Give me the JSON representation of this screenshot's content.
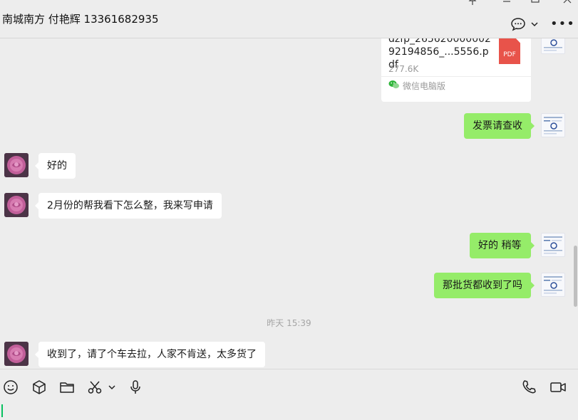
{
  "header": {
    "title": "南城南方 付艳辉 13361682935",
    "icons": [
      "chat-bubble-icon",
      "chevron-down-icon",
      "more-icon"
    ]
  },
  "window_controls": [
    "pin-icon",
    "minimize-icon",
    "maximize-icon",
    "close-icon"
  ],
  "messages": {
    "file": {
      "name": "dzfp_26562000000292194856_...5556.pdf",
      "size": "277.6K",
      "type_label": "PDF",
      "source": "微信电脑版"
    },
    "invoice_notice": "发票请查收",
    "reply_ok": "好的",
    "reply_help": "2月份的帮我看下怎么整，我来写申请",
    "ok_wait": "好的 稍等",
    "goods_received_q": "那批货都收到了吗",
    "timestamp": "昨天 15:39",
    "goods_answer": "收到了，请了个车去拉，人家不肯送，太多货了"
  },
  "toolbar": {
    "icons": [
      "emoji-icon",
      "cube-icon",
      "folder-icon",
      "scissors-icon",
      "chevron-down-icon",
      "microphone-icon",
      "phone-icon",
      "video-icon"
    ]
  },
  "input": {
    "value": ""
  },
  "colors": {
    "background": "#ededed",
    "self_bubble": "#95ec69",
    "other_bubble": "#ffffff",
    "pdf": "#e8534a",
    "caret": "#07c160"
  }
}
